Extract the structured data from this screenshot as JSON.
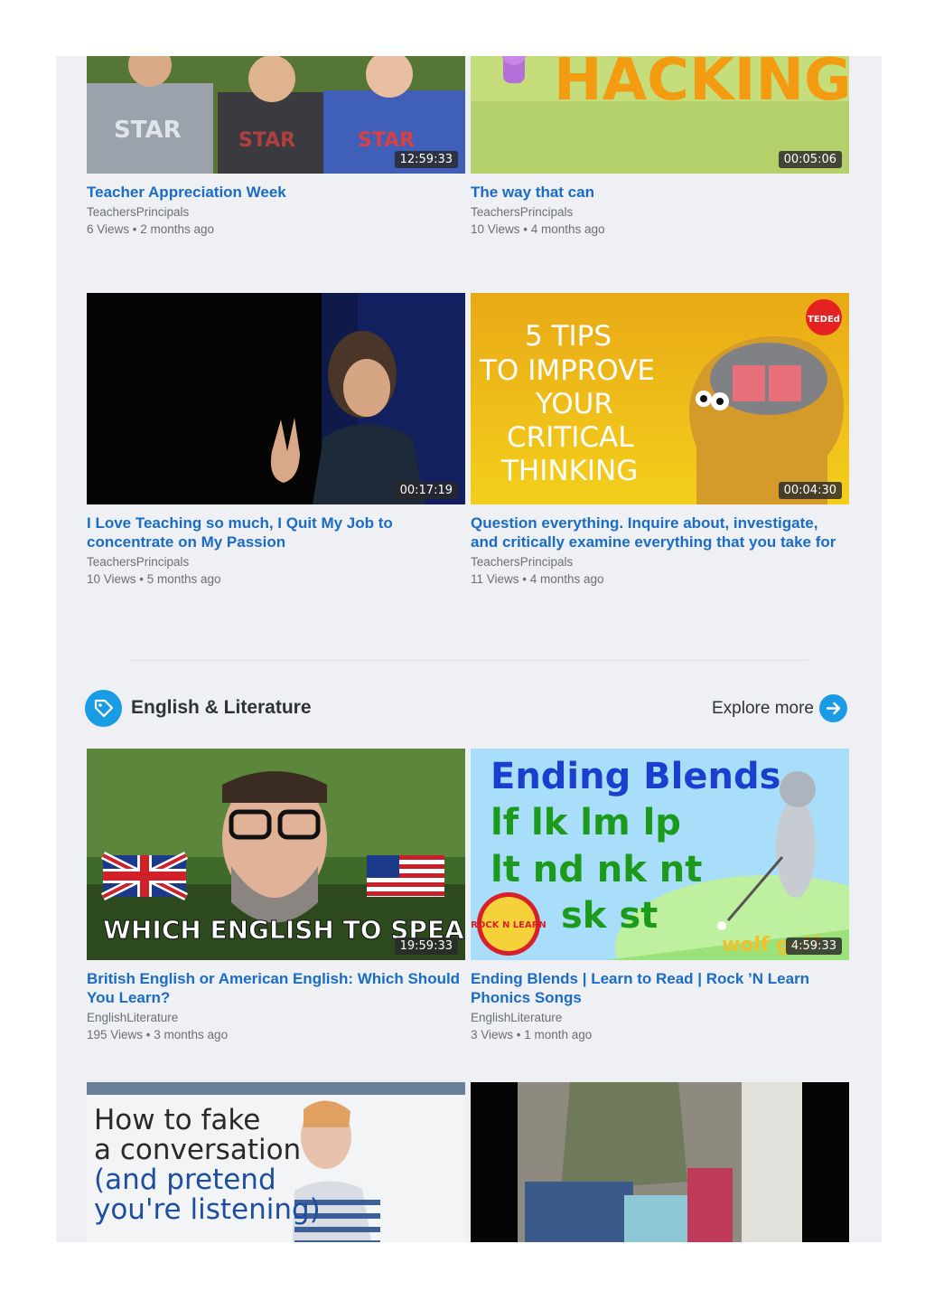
{
  "videos_top": [
    {
      "title": "Teacher Appreciation Week",
      "channel": "TeachersPrincipals",
      "meta": "6 Views • 2 months ago",
      "duration": "12:59:33"
    },
    {
      "title": "The way that can",
      "channel": "TeachersPrincipals",
      "meta": "10 Views • 4 months ago",
      "duration": "00:05:06",
      "thumb_text": "HACKING"
    },
    {
      "title": "I Love Teaching so much, I Quit My Job to concentrate on My Passion",
      "channel": "TeachersPrincipals",
      "meta": "10 Views • 5 months ago",
      "duration": "00:17:19"
    },
    {
      "title": "Question everything. Inquire about, investigate, and critically examine everything that you take for",
      "channel": "TeachersPrincipals",
      "meta": "11 Views • 4 months ago",
      "duration": "00:04:30",
      "thumb_lines": [
        "5 TIPS",
        "TO IMPROVE",
        "YOUR",
        "CRITICAL",
        "THINKING"
      ],
      "badge": "TEDEd"
    }
  ],
  "category": {
    "title": "English & Literature",
    "explore_label": "Explore more",
    "accent": "#1a9be6"
  },
  "videos_cat": [
    {
      "title": "British English or American English: Which Should You Learn?",
      "channel": "EnglishLiterature",
      "meta": "195 Views • 3 months ago",
      "duration": "19:59:33",
      "thumb_text": "WHICH ENGLISH TO SPEAK?"
    },
    {
      "title": "Ending Blends | Learn to Read | Rock ’N Learn Phonics Songs",
      "channel": "EnglishLiterature",
      "meta": "3 Views • 1 month ago",
      "duration": "4:59:33",
      "thumb_heading": "Ending Blends",
      "thumb_row1": "lf  lk  lm  lp",
      "thumb_row2": "lt  nd  nk  nt",
      "thumb_row3": "sk  st",
      "logo": "ROCK N LEARN",
      "corner": "wolf golf"
    },
    {
      "thumb_lines": [
        "How to fake",
        "a conversation",
        "(and pretend",
        "you're listening)"
      ]
    },
    {}
  ]
}
